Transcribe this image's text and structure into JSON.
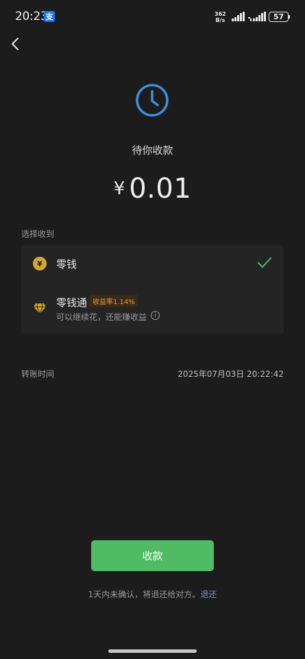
{
  "status_bar": {
    "time": "20:23",
    "app_badge": "支",
    "net_speed_value": "362",
    "net_speed_unit": "B/s",
    "battery": "57"
  },
  "header": {
    "back_icon": "chevron-left-icon"
  },
  "transfer": {
    "status_icon": "clock-icon",
    "status_title": "待你收款",
    "currency_symbol": "¥",
    "amount": "0.01"
  },
  "receive_to": {
    "label": "选择收到",
    "options": [
      {
        "label": "零钱",
        "icon": "coin-icon",
        "icon_glyph": "¥",
        "selected": true
      },
      {
        "label": "零钱通",
        "icon": "diamond-icon",
        "badge": "收益率1.14%",
        "subtitle": "可以继续花，还能赚收益",
        "info_glyph": "i",
        "selected": false
      }
    ]
  },
  "details": {
    "transfer_time_label": "转账时间",
    "transfer_time_value": "2025年07月03日 20:22:42"
  },
  "actions": {
    "receive_label": "收款",
    "footer_note": "1天内未确认，将退还给对方。",
    "return_link": "退还"
  },
  "colors": {
    "background": "#1c1c1c",
    "accent_green": "#4fbb63",
    "clock_blue": "#3d8fe0",
    "badge_orange": "#e99a45",
    "link_blue": "#7b8fd6"
  }
}
